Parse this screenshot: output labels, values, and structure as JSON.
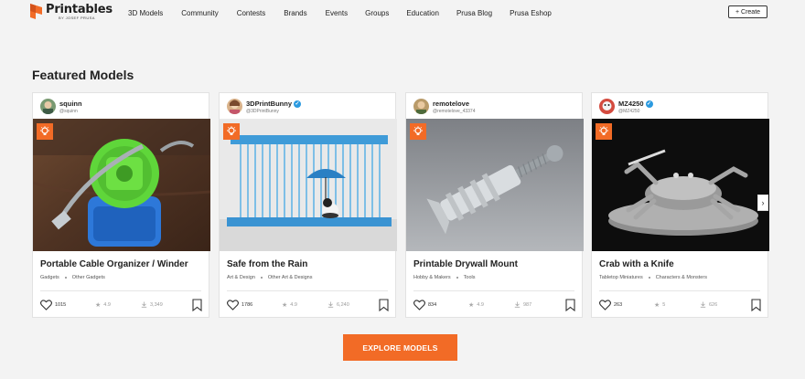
{
  "brand": {
    "name": "Printables",
    "sub": "BY JOSEF PRUSA",
    "accent": "#f26b26"
  },
  "nav": [
    {
      "label": "3D Models"
    },
    {
      "label": "Community"
    },
    {
      "label": "Contests"
    },
    {
      "label": "Brands"
    },
    {
      "label": "Events"
    },
    {
      "label": "Groups"
    },
    {
      "label": "Education"
    },
    {
      "label": "Prusa Blog"
    },
    {
      "label": "Prusa Eshop"
    }
  ],
  "create_label": "Create",
  "section_title": "Featured Models",
  "cards": [
    {
      "author": "squinn",
      "handle": "@squinn",
      "verified": false,
      "title": "Portable Cable Organizer / Winder",
      "cat1": "Gadgets",
      "cat2": "Other Gadgets",
      "likes": "1015",
      "rating": "4.9",
      "downloads": "3,349"
    },
    {
      "author": "3DPrintBunny",
      "handle": "@3DPrintBunny",
      "verified": true,
      "title": "Safe from the Rain",
      "cat1": "Art & Design",
      "cat2": "Other Art & Designs",
      "likes": "1786",
      "rating": "4.9",
      "downloads": "6,240"
    },
    {
      "author": "remotelove",
      "handle": "@remotelove_43374",
      "verified": false,
      "title": "Printable Drywall Mount",
      "cat1": "Hobby & Makers",
      "cat2": "Tools",
      "likes": "834",
      "rating": "4.9",
      "downloads": "987"
    },
    {
      "author": "MZ4250",
      "handle": "@MZ4250",
      "verified": true,
      "title": "Crab with a Knife",
      "cat1": "Tabletop Miniatures",
      "cat2": "Characters & Monsters",
      "likes": "263",
      "rating": "5",
      "downloads": "626"
    }
  ],
  "explore_label": "EXPLORE MODELS"
}
